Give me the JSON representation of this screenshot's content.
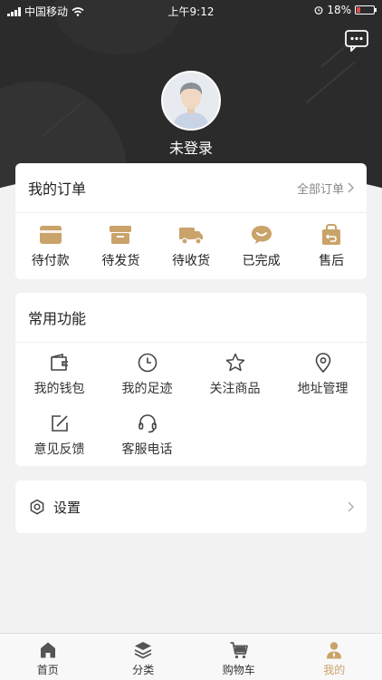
{
  "status_bar": {
    "carrier": "中国移动",
    "time": "上午9:12",
    "battery": "18%"
  },
  "header": {
    "login_text": "未登录"
  },
  "orders": {
    "title": "我的订单",
    "all_link": "全部订单",
    "items": [
      {
        "label": "待付款",
        "icon": "wallet-card-icon"
      },
      {
        "label": "待发货",
        "icon": "box-icon"
      },
      {
        "label": "待收货",
        "icon": "truck-icon"
      },
      {
        "label": "已完成",
        "icon": "chat-done-icon"
      },
      {
        "label": "售后",
        "icon": "return-bag-icon"
      }
    ]
  },
  "functions": {
    "title": "常用功能",
    "items": [
      {
        "label": "我的钱包",
        "icon": "wallet-icon"
      },
      {
        "label": "我的足迹",
        "icon": "clock-icon"
      },
      {
        "label": "关注商品",
        "icon": "star-icon"
      },
      {
        "label": "地址管理",
        "icon": "location-pin-icon"
      },
      {
        "label": "意见反馈",
        "icon": "edit-icon"
      },
      {
        "label": "客服电话",
        "icon": "headset-icon"
      }
    ]
  },
  "settings": {
    "label": "设置"
  },
  "tabbar": {
    "items": [
      {
        "label": "首页",
        "icon": "home-icon"
      },
      {
        "label": "分类",
        "icon": "layers-icon"
      },
      {
        "label": "购物车",
        "icon": "cart-icon"
      },
      {
        "label": "我的",
        "icon": "user-icon",
        "active": true
      }
    ]
  },
  "colors": {
    "accent": "#c9a36a",
    "header_bg": "#2b2b2b",
    "page_bg": "#f2f2f2"
  }
}
